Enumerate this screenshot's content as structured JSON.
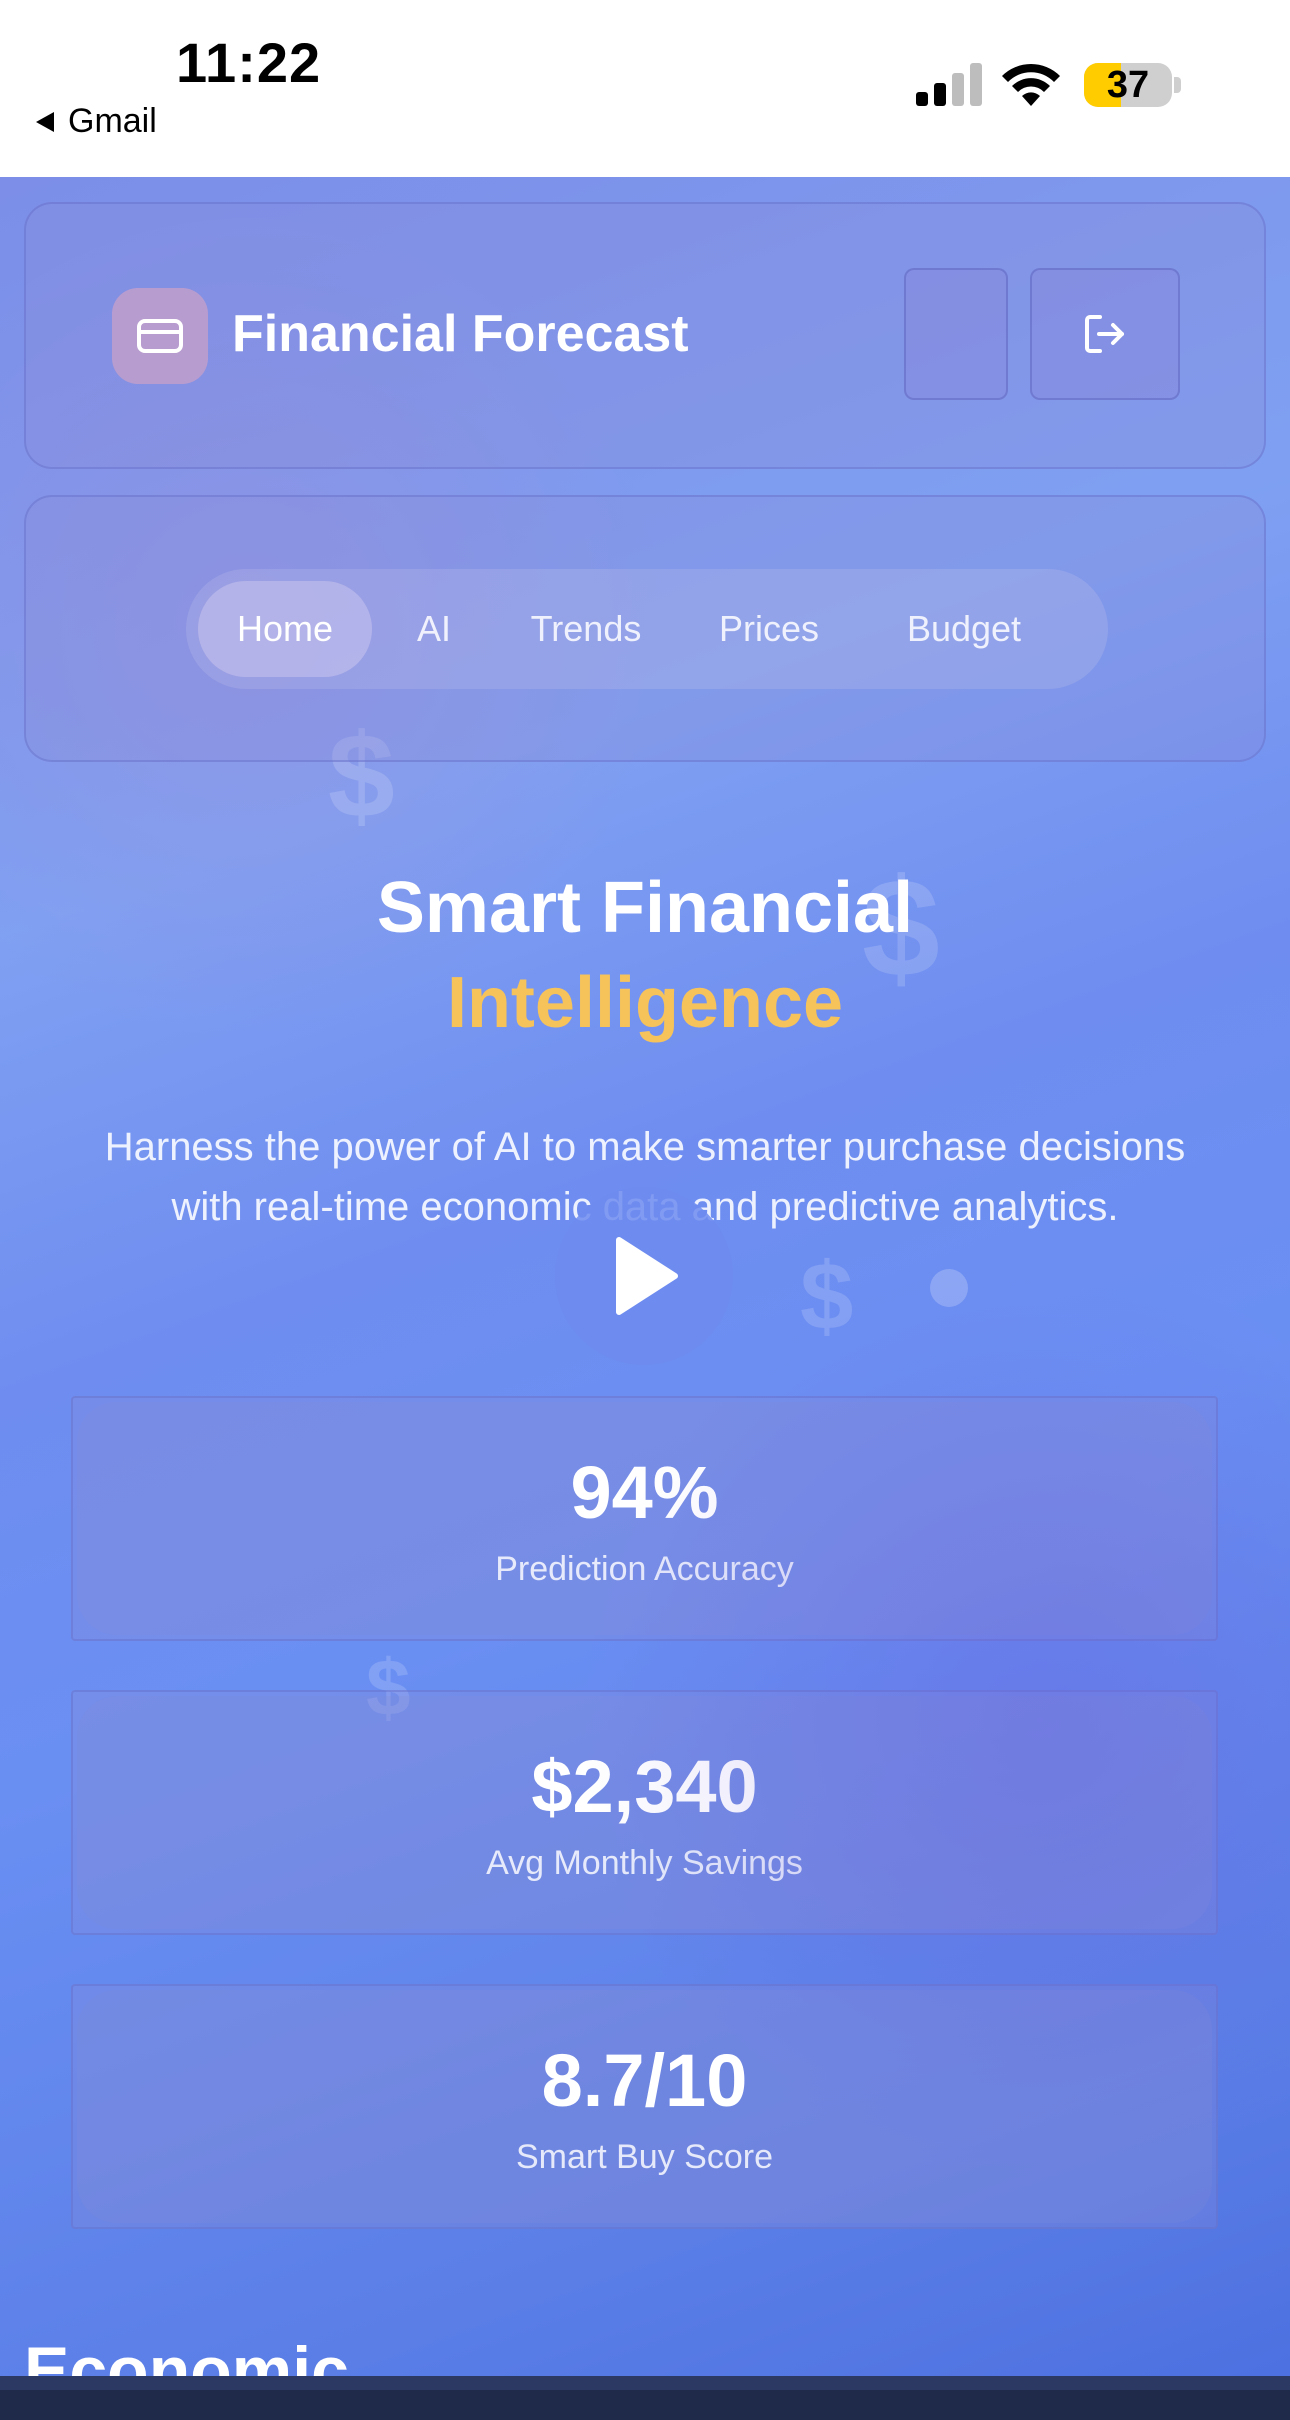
{
  "status_bar": {
    "time": "11:22",
    "back_label": "Gmail",
    "battery": "37",
    "icons": [
      "signal-icon",
      "wifi-icon",
      "battery-icon"
    ]
  },
  "header": {
    "title": "Financial Forecast",
    "logo_icon": "credit-card-icon",
    "logout_icon": "logout-icon"
  },
  "nav": {
    "items": [
      {
        "label": "Home",
        "active": true
      },
      {
        "label": "AI",
        "active": false
      },
      {
        "label": "Trends",
        "active": false
      },
      {
        "label": "Prices",
        "active": false
      },
      {
        "label": "Budget",
        "active": false
      }
    ]
  },
  "hero": {
    "title_line1": "Smart Financial",
    "title_line2": "Intelligence",
    "subtitle": "Harness the power of AI to make smarter purchase decisions with real-time economic data and predictive analytics.",
    "accent_color": "#f6c35b"
  },
  "stats": [
    {
      "value": "94%",
      "label": "Prediction Accuracy"
    },
    {
      "value": "$2,340",
      "label": "Avg Monthly Savings"
    },
    {
      "value": "8.7/10",
      "label": "Smart Buy Score"
    }
  ],
  "section": {
    "heading": "Economic"
  },
  "decor": {
    "dollar_symbol": "$"
  }
}
